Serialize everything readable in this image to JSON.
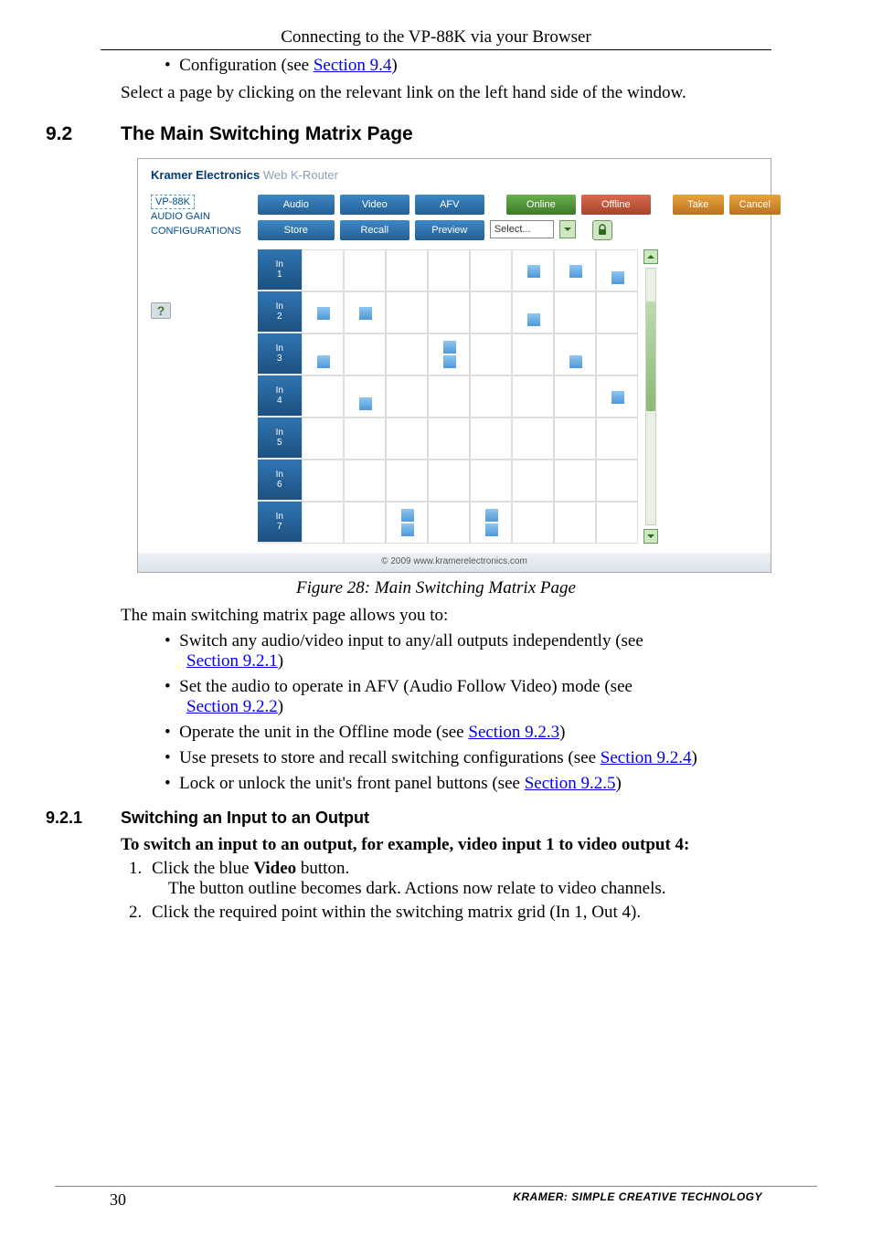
{
  "running_head": "Connecting to the VP-88K via your Browser",
  "intro_bullet_pre": "Configuration (see ",
  "intro_bullet_link": "Section 9.4",
  "intro_bullet_post": ")",
  "select_line": "Select a page by clicking on the relevant link on the left hand side of the window.",
  "sect92_num": "9.2",
  "sect92_title": "The Main Switching Matrix Page",
  "fig_caption": "Figure 28: Main Switching Matrix Page",
  "after_fig_lead": "The main switching matrix page allows you to:",
  "bul1_a": "Switch any audio/video input to any/all outputs independently (see ",
  "bul1_link": "Section 9.2.1",
  "bul1_b": ")",
  "bul2_a": "Set the audio to operate in AFV (Audio Follow Video) mode (see ",
  "bul2_link": "Section 9.2.2",
  "bul2_b": ")",
  "bul3_a": "Operate the unit in the Offline mode (see ",
  "bul3_link": "Section 9.2.3",
  "bul3_b": ")",
  "bul4_a": "Use presets to store and recall switching configurations (see ",
  "bul4_link": "Section 9.2.4",
  "bul4_b": ")",
  "bul5_a": "Lock or unlock the unit's front panel buttons (see ",
  "bul5_link": "Section 9.2.5",
  "bul5_b": ")",
  "sub921_num": "9.2.1",
  "sub921_title": "Switching an Input to an Output",
  "instr_heading": "To switch an input to an output, for example, video input 1 to video output 4:",
  "step1_a": "Click the blue ",
  "step1_bold": "Video",
  "step1_b": " button.",
  "step1_line2": "The button outline becomes dark. Actions now relate to video channels.",
  "step2": "Click the required point within the switching matrix grid (In 1, Out 4).",
  "page_number": "30",
  "footer_text": "KRAMER:  SIMPLE CREATIVE TECHNOLOGY",
  "shot": {
    "brand_strong": "Kramer Electronics",
    "brand_rest": " Web K-Router",
    "side": {
      "vp": "VP-88K",
      "gain": "AUDIO GAIN",
      "conf": "CONFIGURATIONS",
      "help": "?"
    },
    "row1": {
      "audio": "Audio",
      "video": "Video",
      "afv": "AFV",
      "online": "Online",
      "offline": "Offline",
      "take": "Take",
      "cancel": "Cancel"
    },
    "row2": {
      "store": "Store",
      "recall": "Recall",
      "preview": "Preview",
      "select": "Select..."
    },
    "rows": [
      "In 1",
      "In 2",
      "In 3",
      "In 4",
      "In 5",
      "In 6",
      "In 7"
    ],
    "footer": "© 2009 www.kramerelectronics.com"
  }
}
